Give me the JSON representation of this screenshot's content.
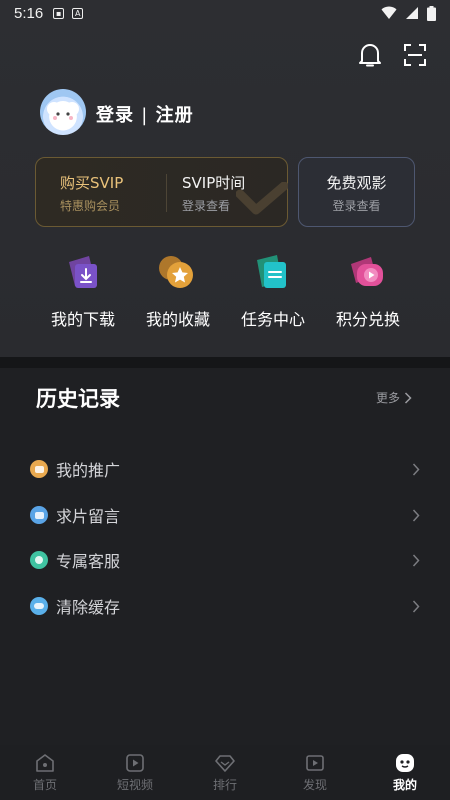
{
  "status_bar": {
    "time": "5:16"
  },
  "header": {
    "notification_icon": "bell-icon",
    "scan_icon": "scan-icon"
  },
  "profile": {
    "login_label": "登录",
    "separator": "|",
    "register_label": "注册"
  },
  "svip_card": {
    "buy_title": "购买SVIP",
    "buy_subtitle": "特惠购会员",
    "time_title": "SVIP时间",
    "time_subtitle": "登录查看"
  },
  "free_card": {
    "title": "免费观影",
    "subtitle": "登录查看"
  },
  "features": [
    {
      "label": "我的下载",
      "icon": "download-icon"
    },
    {
      "label": "我的收藏",
      "icon": "star-icon"
    },
    {
      "label": "任务中心",
      "icon": "task-icon"
    },
    {
      "label": "积分兑换",
      "icon": "play-icon"
    }
  ],
  "history": {
    "title": "历史记录",
    "more_label": "更多"
  },
  "menu": [
    {
      "label": "我的推广",
      "color": "#e9a94f"
    },
    {
      "label": "求片留言",
      "color": "#5aa4e6"
    },
    {
      "label": "专属客服",
      "color": "#3fc3a1"
    },
    {
      "label": "清除缓存",
      "color": "#5ab0ea"
    }
  ],
  "tabs": [
    {
      "label": "首页",
      "active": false
    },
    {
      "label": "短视频",
      "active": false
    },
    {
      "label": "排行",
      "active": false
    },
    {
      "label": "发现",
      "active": false
    },
    {
      "label": "我的",
      "active": true
    }
  ],
  "colors": {
    "gold": "#e9c27a",
    "blue_text": "#c3c8d8"
  }
}
